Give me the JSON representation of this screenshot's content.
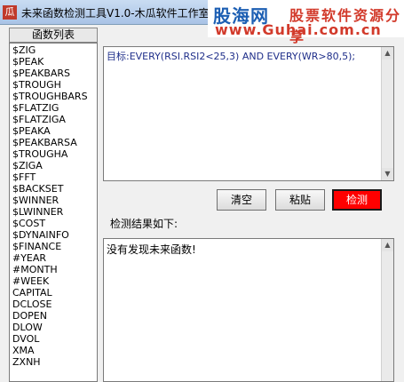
{
  "window": {
    "app_icon": "瓜",
    "title": "未来函数检测工具V1.0-木瓜软件工作室"
  },
  "watermark": {
    "logo": "股海网",
    "slogan": "股票软件资源分享",
    "url": "www.Guhai.com.cn"
  },
  "function_list": {
    "header": "函数列表",
    "items": [
      "$ZIG",
      "$PEAK",
      "$PEAKBARS",
      "$TROUGH",
      "$TROUGHBARS",
      "$FLATZIG",
      "$FLATZIGA",
      "$PEAKA",
      "$PEAKBARSA",
      "$TROUGHA",
      "$ZIGA",
      "$FFT",
      "$BACKSET",
      "$WINNER",
      "$LWINNER",
      "$COST",
      "$DYNAINFO",
      "$FINANCE",
      "#YEAR",
      "#MONTH",
      "#WEEK",
      "CAPITAL",
      "DCLOSE",
      "DOPEN",
      "DLOW",
      "DVOL",
      "XMA",
      "ZXNH"
    ]
  },
  "editor": {
    "content": "目标:EVERY(RSI.RSI2<25,3) AND EVERY(WR>80,5);"
  },
  "buttons": {
    "clear": "清空",
    "paste": "粘贴",
    "detect": "检测"
  },
  "result": {
    "label": "检测结果如下:",
    "text": "没有发现未来函数!"
  }
}
